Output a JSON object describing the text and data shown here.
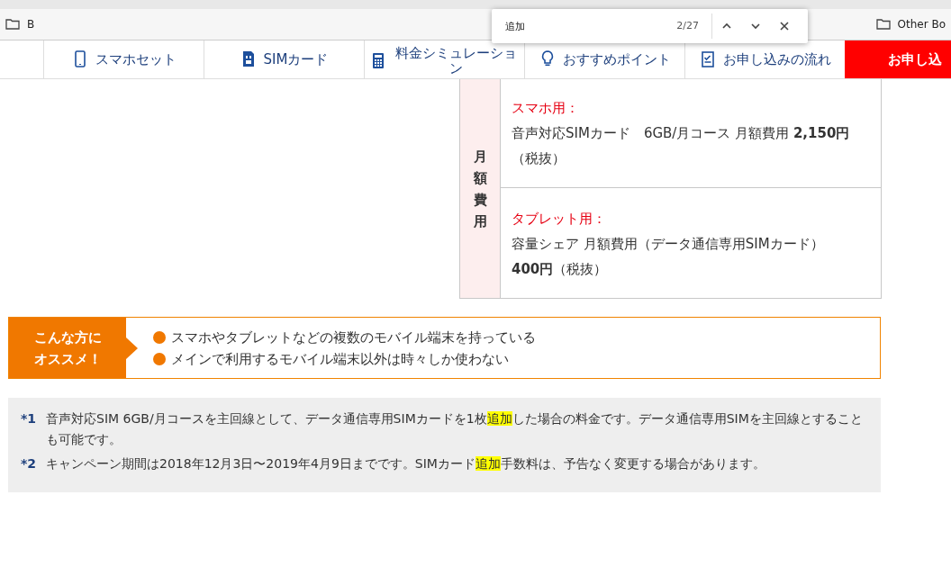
{
  "bookmarks_bar": {
    "items": [
      {
        "label": "B"
      }
    ],
    "other": "Other Bo"
  },
  "find_bar": {
    "query": "追加",
    "count": "2/27"
  },
  "nav": {
    "items": [
      {
        "label": "スマホセット"
      },
      {
        "label": "SIMカード"
      },
      {
        "label": "料金シミュレーション"
      },
      {
        "label": "おすすめポイント"
      },
      {
        "label": "お申し込みの流れ"
      }
    ],
    "apply_button": "お申し込"
  },
  "fee_table": {
    "header": "月額費用",
    "rows": [
      {
        "title": "スマホ用：",
        "lines": [
          "音声対応SIMカード　6GB/月コース 月額費用 **2,150円**（税抜）"
        ]
      },
      {
        "title": "タブレット用：",
        "lines": [
          "容量シェア 月額費用（データ通信専用SIMカード）",
          "**400円**（税抜）"
        ]
      }
    ]
  },
  "recommend": {
    "label_lines": [
      "こんな方に",
      "オススメ！"
    ],
    "points": [
      "スマホやタブレットなどの複数のモバイル端末を持っている",
      "メインで利用するモバイル端末以外は時々しか使わない"
    ]
  },
  "notes": [
    {
      "mark": "*1",
      "segments": [
        {
          "text": "音声対応SIM 6GB/月コースを主回線として、データ通信専用SIMカードを1枚",
          "highlighted": false
        },
        {
          "text": "追加",
          "highlighted": true
        },
        {
          "text": "した場合の料金です。データ通信専用SIMを主回線とすることも可能です。",
          "highlighted": false
        }
      ]
    },
    {
      "mark": "*2",
      "segments": [
        {
          "text": "キャンペーン期間は2018年12月3日〜2019年4月9日までです。SIMカード",
          "highlighted": false
        },
        {
          "text": "追加",
          "highlighted": true
        },
        {
          "text": "手数料は、予告なく変更する場合があります。",
          "highlighted": false
        }
      ]
    }
  ]
}
